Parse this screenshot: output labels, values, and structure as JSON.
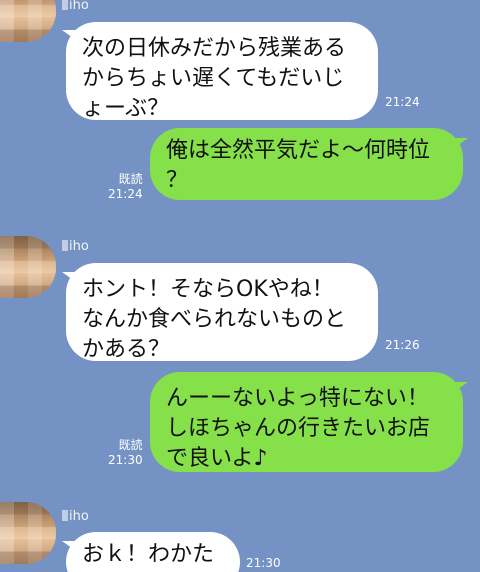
{
  "messages": [
    {
      "direction": "in",
      "sender": "iho",
      "text": "次の日休みだから残業ある\nからちょい遅くてもだいじ\nょーぶ？",
      "time": "21:24"
    },
    {
      "direction": "out",
      "read_label": "既読",
      "text": "俺は全然平気だよ〜何時位\n？",
      "time": "21:24"
    },
    {
      "direction": "in",
      "sender": "iho",
      "text": "ホント！そならOKやね！\nなんか食べられないものと\nかある？",
      "time": "21:26"
    },
    {
      "direction": "out",
      "read_label": "既読",
      "text": "んーーないよっ特にない！\nしほちゃんの行きたいお店\nで良いよ♪",
      "time": "21:30"
    },
    {
      "direction": "in",
      "sender": "iho",
      "text": "おｋ！わかた",
      "time": "21:30"
    }
  ],
  "colors": {
    "background": "#7493c4",
    "bubble_in": "#ffffff",
    "bubble_out": "#85e049"
  }
}
